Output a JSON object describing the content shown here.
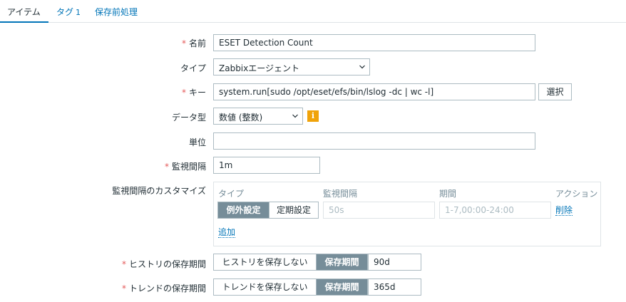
{
  "tabs": [
    {
      "label": "アイテム",
      "count": ""
    },
    {
      "label": "タグ",
      "count": "1"
    },
    {
      "label": "保存前処理",
      "count": ""
    }
  ],
  "form": {
    "name": {
      "label": "名前",
      "value": "ESET Detection Count"
    },
    "type": {
      "label": "タイプ",
      "value": "Zabbixエージェント"
    },
    "key": {
      "label": "キー",
      "value": "system.run[sudo /opt/eset/efs/bin/lslog -dc | wc -l]",
      "button": "選択"
    },
    "data_type": {
      "label": "データ型",
      "value": "数値 (整数)",
      "info": "i"
    },
    "units": {
      "label": "単位",
      "value": ""
    },
    "interval": {
      "label": "監視間隔",
      "value": "1m"
    },
    "custom_intervals": {
      "label": "監視間隔のカスタマイズ",
      "columns": [
        "タイプ",
        "監視間隔",
        "期間",
        "アクション"
      ],
      "row": {
        "type_options": [
          "例外設定",
          "定期設定"
        ],
        "interval_placeholder": "50s",
        "period_placeholder": "1-7,00:00-24:00",
        "remove": "削除"
      },
      "add": "追加"
    },
    "history": {
      "label": "ヒストリの保存期間",
      "options": [
        "ヒストリを保存しない",
        "保存期間"
      ],
      "value": "90d"
    },
    "trends": {
      "label": "トレンドの保存期間",
      "options": [
        "トレンドを保存しない",
        "保存期間"
      ],
      "value": "365d"
    }
  },
  "colors": {
    "accent": "#0275b8",
    "required": "#e45959",
    "segment_active": "#768d99",
    "info": "#f0a30a"
  }
}
